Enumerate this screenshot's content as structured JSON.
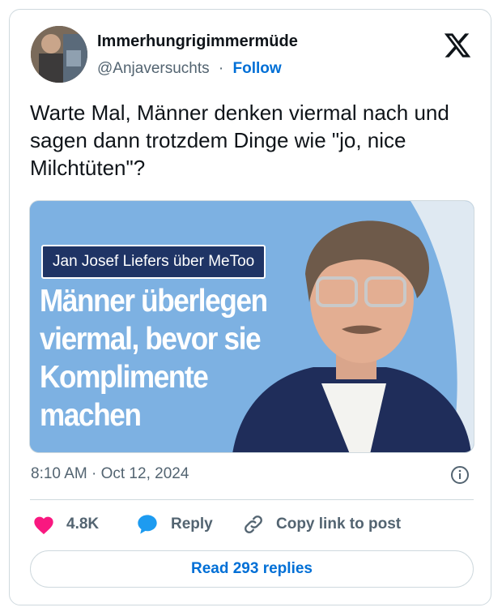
{
  "author": {
    "name": "Immerhungrigimmermüde",
    "handle": "@Anjaversuchts",
    "separator": "·",
    "follow_label": "Follow"
  },
  "tweet": {
    "text": "Warte Mal, Männer denken viermal nach und sagen dann trotzdem Dinge wie \"jo, nice Milchtüten\"?",
    "timestamp": "8:10 AM · Oct 12, 2024"
  },
  "media": {
    "tag": "Jan Josef Liefers über MeToo",
    "headline": "Männer überlegen viermal, bevor sie Komplimente machen"
  },
  "actions": {
    "likes": "4.8K",
    "reply_label": "Reply",
    "copy_label": "Copy link to post"
  },
  "read_replies_label": "Read 293 replies",
  "colors": {
    "like": "#f91880",
    "reply": "#1d9bf0",
    "link": "#006fd6",
    "media_bg": "#7db1e2",
    "tag_bg": "#1f3465"
  },
  "icons": [
    "x-logo-icon",
    "heart-icon",
    "reply-bubble-icon",
    "link-icon",
    "info-icon"
  ]
}
